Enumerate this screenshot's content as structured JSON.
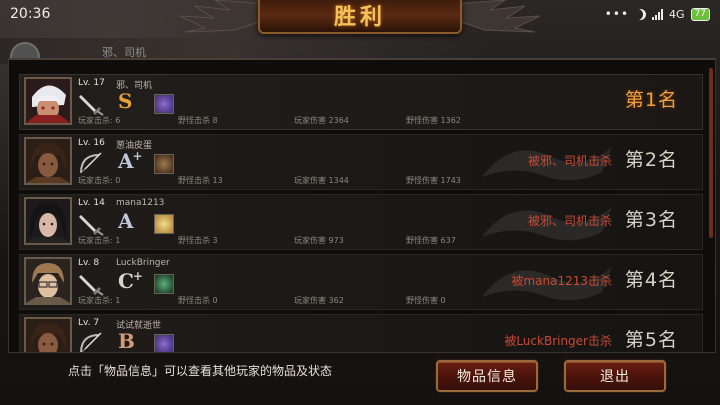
{
  "status_bar": {
    "time": "20:36",
    "network": "4G",
    "battery": "77"
  },
  "header": {
    "title": "胜利",
    "behind_player": "邪、司机"
  },
  "players": [
    {
      "level": "Lv. 17",
      "name": "邪、司机",
      "grade": "S",
      "grade_plus": "",
      "grade_color": "#e8a13a",
      "player_kills_label": "玩家击杀: 6",
      "monster_kills_label": "野怪击杀 8",
      "player_damage_label": "玩家伤害 2364",
      "monster_damage_label": "野怪伤害 1362",
      "killed_by": "",
      "rank": "第1名",
      "weapon_icon": "sword-icon",
      "item_color": "#5a3f9a"
    },
    {
      "level": "Lv. 16",
      "name": "葱油皮蛋",
      "grade": "A",
      "grade_plus": "+",
      "grade_color": "#bfc8d8",
      "player_kills_label": "玩家击杀: 0",
      "monster_kills_label": "野怪击杀 13",
      "player_damage_label": "玩家伤害 1344",
      "monster_damage_label": "野怪伤害 1743",
      "killed_by": "被邪、司机击杀",
      "rank": "第2名",
      "weapon_icon": "bow-icon",
      "item_color": "#7a5a3a"
    },
    {
      "level": "Lv. 14",
      "name": "mana1213",
      "grade": "A",
      "grade_plus": "",
      "grade_color": "#bfc8d8",
      "player_kills_label": "玩家击杀: 1",
      "monster_kills_label": "野怪击杀 3",
      "player_damage_label": "玩家伤害 973",
      "monster_damage_label": "野怪伤害 637",
      "killed_by": "被邪、司机击杀",
      "rank": "第3名",
      "weapon_icon": "sword-icon",
      "item_color": "#c9a050"
    },
    {
      "level": "Lv. 8",
      "name": "LuckBringer",
      "grade": "C",
      "grade_plus": "+",
      "grade_color": "#d8d4cc",
      "player_kills_label": "玩家击杀: 1",
      "monster_kills_label": "野怪击杀 0",
      "player_damage_label": "玩家伤害 362",
      "monster_damage_label": "野怪伤害 0",
      "killed_by": "被mana1213击杀",
      "rank": "第4名",
      "weapon_icon": "sword-icon",
      "item_color": "#2f6a4a"
    },
    {
      "level": "Lv. 7",
      "name": "试试就逝世",
      "grade": "B",
      "grade_plus": "",
      "grade_color": "#d59a78",
      "player_kills_label": "",
      "monster_kills_label": "",
      "player_damage_label": "",
      "monster_damage_label": "",
      "killed_by": "被LuckBringer击杀",
      "rank": "第5名",
      "weapon_icon": "bow-icon",
      "item_color": "#5a3f9a"
    }
  ],
  "footer": {
    "hint": "点击「物品信息」可以查看其他玩家的物品及状态",
    "item_info_label": "物品信息",
    "exit_label": "退出"
  }
}
